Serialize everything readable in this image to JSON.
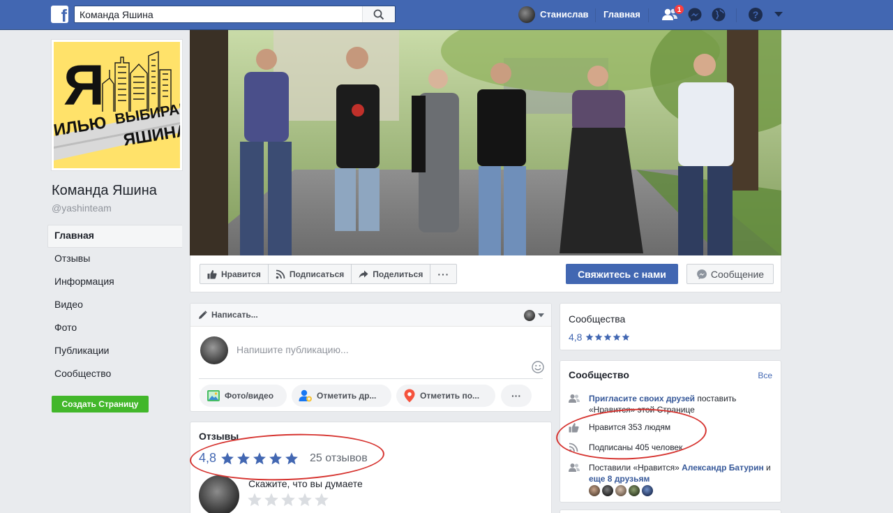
{
  "topbar": {
    "logo": "f",
    "search_value": "Команда Яшина",
    "user_name": "Станислав",
    "home": "Главная",
    "friend_requests_badge": "1",
    "icons": [
      "facebook-logo",
      "search-icon",
      "friends-icon",
      "messenger-icon",
      "globe-icon",
      "help-icon",
      "chevron-down-icon"
    ]
  },
  "profile": {
    "logo_letter": "Я",
    "logo_line1": "ВЫБИРАЮ",
    "logo_line2_left": "ИЛЬЮ",
    "logo_line2_right": "ЯШИНА",
    "name": "Команда Яшина",
    "handle": "@yashinteam"
  },
  "left_nav": {
    "items": [
      {
        "label": "Главная"
      },
      {
        "label": "Отзывы"
      },
      {
        "label": "Информация"
      },
      {
        "label": "Видео"
      },
      {
        "label": "Фото"
      },
      {
        "label": "Публикации"
      },
      {
        "label": "Сообщество"
      }
    ],
    "create_page": "Создать Страницу"
  },
  "actions": {
    "like": "Нравится",
    "follow": "Подписаться",
    "share": "Поделиться",
    "more": "···",
    "contact": "Свяжитесь с нами",
    "message": "Сообщение"
  },
  "composer": {
    "write": "Написать...",
    "placeholder": "Напишите публикацию...",
    "photo": "Фото/видео",
    "tag": "Отметить др...",
    "checkin": "Отметить по...",
    "more": "···"
  },
  "reviews": {
    "title": "Отзывы",
    "rating": "4,8",
    "stars": 5,
    "count": "25 отзывов",
    "ask": "Скажите, что вы думаете"
  },
  "communities": {
    "title": "Сообщества",
    "rating": "4,8"
  },
  "community": {
    "title": "Сообщество",
    "all": "Все",
    "invite_link": "Пригласите своих друзей",
    "invite_rest": " поставить «Нравится» этой Странице",
    "likes": "Нравится 353 людям",
    "follows": "Подписаны 405 человек",
    "friends_prefix": "Поставили «Нравится» ",
    "friend_name": "Александр Батурин",
    "friends_and": " и ",
    "friends_more": "еще 8 друзьям"
  },
  "colors": {
    "facebook_blue": "#4267b2",
    "link": "#365899",
    "green": "#42b72a",
    "annotation_red": "#d6332f",
    "logo_yellow": "#ffe26a"
  }
}
